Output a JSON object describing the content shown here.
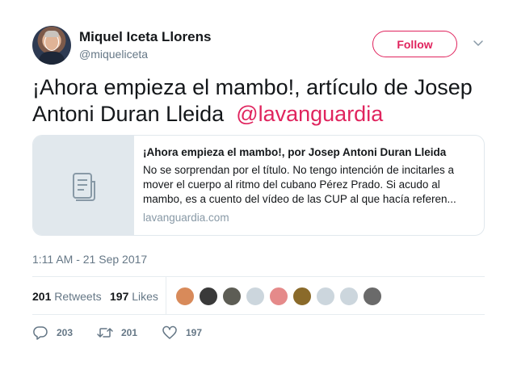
{
  "author": {
    "name": "Miquel Iceta Llorens",
    "handle": "@miqueliceta",
    "avatar_icon": "profile-photo"
  },
  "follow_label": "Follow",
  "tweet": {
    "text": "¡Ahora empieza el mambo!, artículo de Josep Antoni Duran Lleida",
    "mention": "@lavanguardia"
  },
  "card": {
    "title": "¡Ahora empieza el mambo!, por Josep Antoni Duran Lleida",
    "description": "No se sorprendan por el título. No tengo intención de incitarles a mover el cuerpo al ritmo del cubano Pérez Prado. Si acudo al mambo, es a cuento del vídeo de las CUP al que hacía referen...",
    "domain": "lavanguardia.com",
    "thumb_icon": "document-icon"
  },
  "timestamp": "1:11 AM - 21 Sep 2017",
  "stats": {
    "retweets_count": "201",
    "retweets_label": "Retweets",
    "likes_count": "197",
    "likes_label": "Likes"
  },
  "likers": [
    {
      "color": "#d88a5a"
    },
    {
      "color": "#3a3a3a"
    },
    {
      "color": "#5d5d55"
    },
    {
      "color": "#ccd6dd"
    },
    {
      "color": "#e58a8a"
    },
    {
      "color": "#8a6a2a"
    },
    {
      "color": "#ccd6dd"
    },
    {
      "color": "#ccd6dd"
    },
    {
      "color": "#6a6a6a"
    }
  ],
  "actions": {
    "replies": "203",
    "retweets": "201",
    "likes": "197"
  },
  "colors": {
    "accent": "#e0245e",
    "muted": "#657786",
    "border": "#e1e8ed"
  }
}
